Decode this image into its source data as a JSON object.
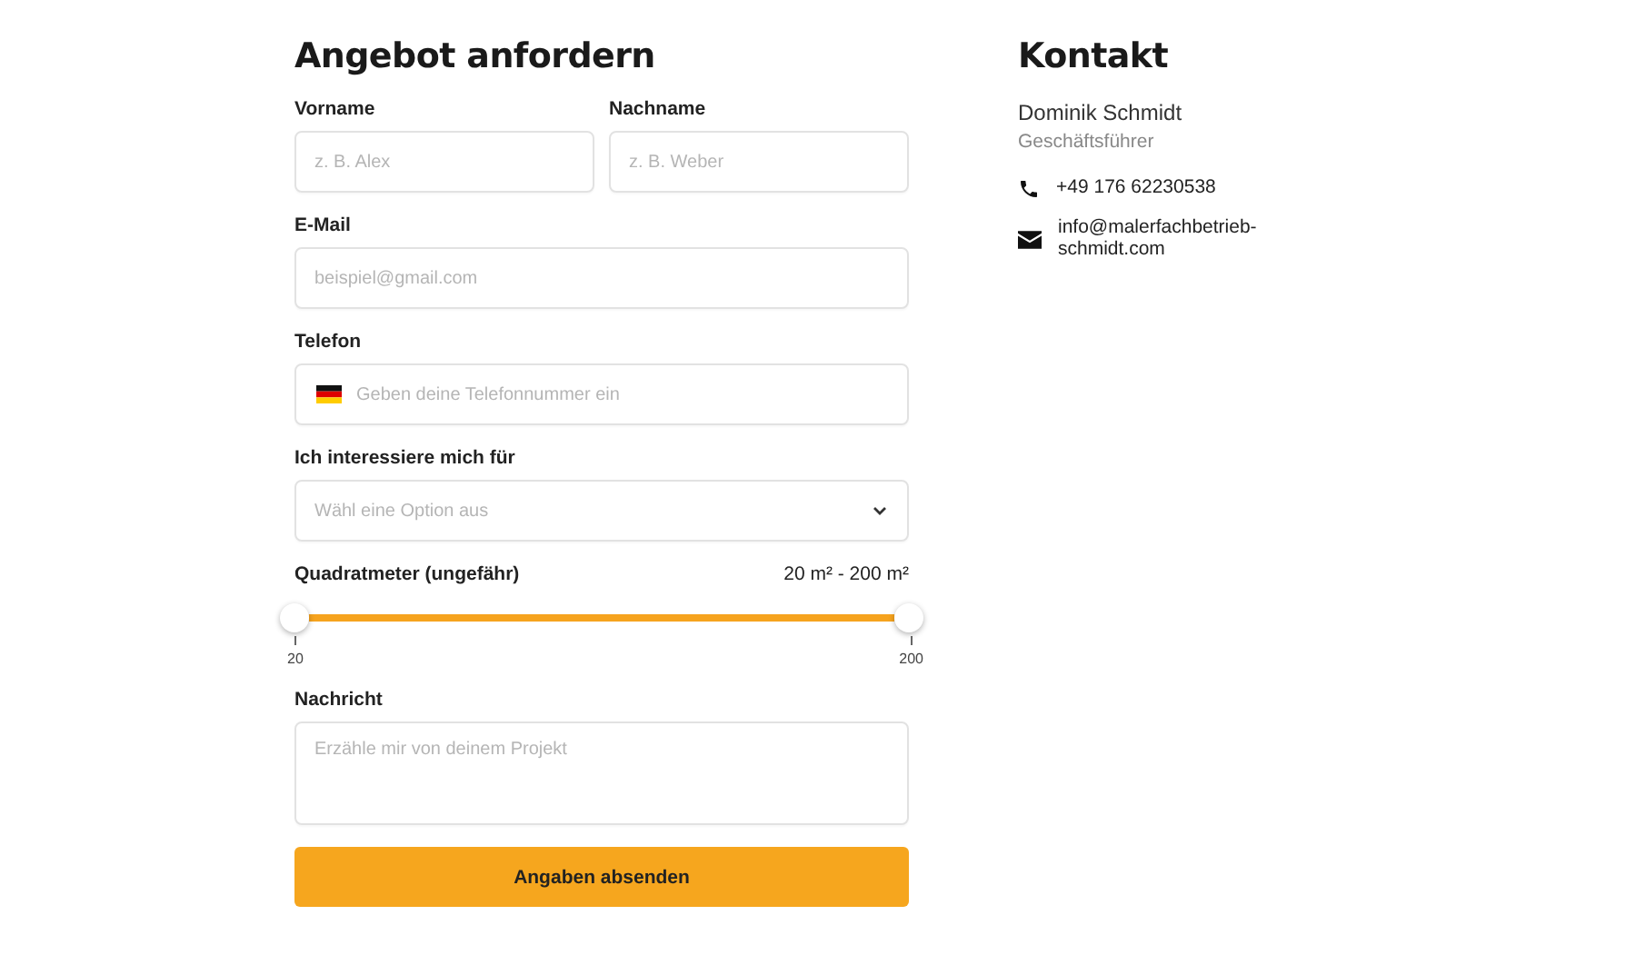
{
  "form": {
    "title": "Angebot anfordern",
    "name_fields": [
      {
        "label": "Vorname",
        "placeholder": "z. B. Alex"
      },
      {
        "label": "Nachname",
        "placeholder": "z. B. Weber"
      }
    ],
    "email": {
      "label": "E-Mail",
      "placeholder": "beispiel@gmail.com"
    },
    "phone": {
      "label": "Telefon",
      "placeholder": "Geben deine Telefonnummer ein"
    },
    "interest": {
      "label": "Ich interessiere mich für",
      "placeholder": "Wähl eine Option aus"
    },
    "area": {
      "label": "Quadratmeter (ungefähr)",
      "reading": "20 m² - 200 m²",
      "thumbs": [
        {
          "level": 0
        },
        {
          "level": 1
        }
      ],
      "min_label": "20",
      "max_label": "200"
    },
    "message": {
      "label": "Nachricht",
      "placeholder": "Erzähle mir von deinem Projekt"
    },
    "submit": "Angaben absenden"
  },
  "contact": {
    "title": "Kontakt",
    "name": "Dominik Schmidt",
    "role": "Geschäftsführer",
    "items": [
      {
        "kind": "phone",
        "text": "+49 176 62230538"
      },
      {
        "kind": "email",
        "text": "info@malerfachbetrieb-schmidt.com"
      }
    ]
  }
}
